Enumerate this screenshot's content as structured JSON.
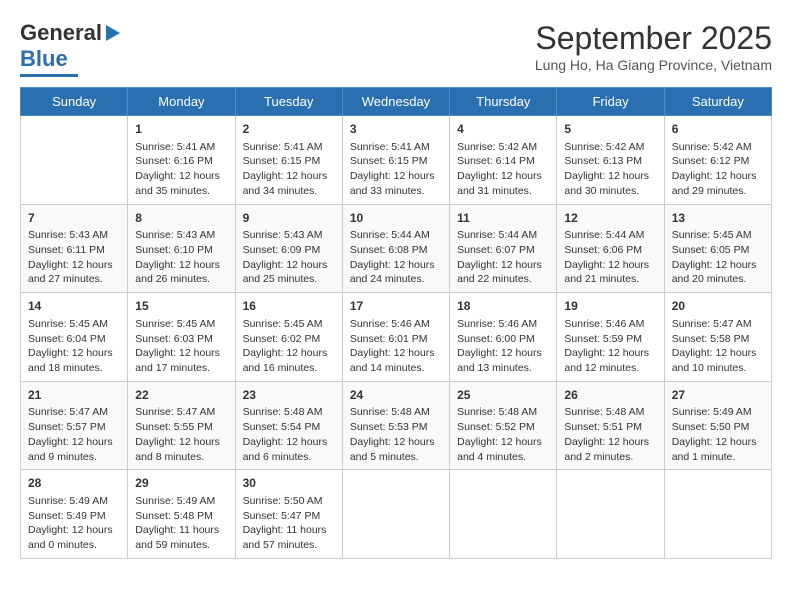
{
  "logo": {
    "line1": "General",
    "line2": "Blue"
  },
  "title": "September 2025",
  "subtitle": "Lung Ho, Ha Giang Province, Vietnam",
  "days_of_week": [
    "Sunday",
    "Monday",
    "Tuesday",
    "Wednesday",
    "Thursday",
    "Friday",
    "Saturday"
  ],
  "weeks": [
    [
      {
        "num": "",
        "info": ""
      },
      {
        "num": "1",
        "info": "Sunrise: 5:41 AM\nSunset: 6:16 PM\nDaylight: 12 hours\nand 35 minutes."
      },
      {
        "num": "2",
        "info": "Sunrise: 5:41 AM\nSunset: 6:15 PM\nDaylight: 12 hours\nand 34 minutes."
      },
      {
        "num": "3",
        "info": "Sunrise: 5:41 AM\nSunset: 6:15 PM\nDaylight: 12 hours\nand 33 minutes."
      },
      {
        "num": "4",
        "info": "Sunrise: 5:42 AM\nSunset: 6:14 PM\nDaylight: 12 hours\nand 31 minutes."
      },
      {
        "num": "5",
        "info": "Sunrise: 5:42 AM\nSunset: 6:13 PM\nDaylight: 12 hours\nand 30 minutes."
      },
      {
        "num": "6",
        "info": "Sunrise: 5:42 AM\nSunset: 6:12 PM\nDaylight: 12 hours\nand 29 minutes."
      }
    ],
    [
      {
        "num": "7",
        "info": "Sunrise: 5:43 AM\nSunset: 6:11 PM\nDaylight: 12 hours\nand 27 minutes."
      },
      {
        "num": "8",
        "info": "Sunrise: 5:43 AM\nSunset: 6:10 PM\nDaylight: 12 hours\nand 26 minutes."
      },
      {
        "num": "9",
        "info": "Sunrise: 5:43 AM\nSunset: 6:09 PM\nDaylight: 12 hours\nand 25 minutes."
      },
      {
        "num": "10",
        "info": "Sunrise: 5:44 AM\nSunset: 6:08 PM\nDaylight: 12 hours\nand 24 minutes."
      },
      {
        "num": "11",
        "info": "Sunrise: 5:44 AM\nSunset: 6:07 PM\nDaylight: 12 hours\nand 22 minutes."
      },
      {
        "num": "12",
        "info": "Sunrise: 5:44 AM\nSunset: 6:06 PM\nDaylight: 12 hours\nand 21 minutes."
      },
      {
        "num": "13",
        "info": "Sunrise: 5:45 AM\nSunset: 6:05 PM\nDaylight: 12 hours\nand 20 minutes."
      }
    ],
    [
      {
        "num": "14",
        "info": "Sunrise: 5:45 AM\nSunset: 6:04 PM\nDaylight: 12 hours\nand 18 minutes."
      },
      {
        "num": "15",
        "info": "Sunrise: 5:45 AM\nSunset: 6:03 PM\nDaylight: 12 hours\nand 17 minutes."
      },
      {
        "num": "16",
        "info": "Sunrise: 5:45 AM\nSunset: 6:02 PM\nDaylight: 12 hours\nand 16 minutes."
      },
      {
        "num": "17",
        "info": "Sunrise: 5:46 AM\nSunset: 6:01 PM\nDaylight: 12 hours\nand 14 minutes."
      },
      {
        "num": "18",
        "info": "Sunrise: 5:46 AM\nSunset: 6:00 PM\nDaylight: 12 hours\nand 13 minutes."
      },
      {
        "num": "19",
        "info": "Sunrise: 5:46 AM\nSunset: 5:59 PM\nDaylight: 12 hours\nand 12 minutes."
      },
      {
        "num": "20",
        "info": "Sunrise: 5:47 AM\nSunset: 5:58 PM\nDaylight: 12 hours\nand 10 minutes."
      }
    ],
    [
      {
        "num": "21",
        "info": "Sunrise: 5:47 AM\nSunset: 5:57 PM\nDaylight: 12 hours\nand 9 minutes."
      },
      {
        "num": "22",
        "info": "Sunrise: 5:47 AM\nSunset: 5:55 PM\nDaylight: 12 hours\nand 8 minutes."
      },
      {
        "num": "23",
        "info": "Sunrise: 5:48 AM\nSunset: 5:54 PM\nDaylight: 12 hours\nand 6 minutes."
      },
      {
        "num": "24",
        "info": "Sunrise: 5:48 AM\nSunset: 5:53 PM\nDaylight: 12 hours\nand 5 minutes."
      },
      {
        "num": "25",
        "info": "Sunrise: 5:48 AM\nSunset: 5:52 PM\nDaylight: 12 hours\nand 4 minutes."
      },
      {
        "num": "26",
        "info": "Sunrise: 5:48 AM\nSunset: 5:51 PM\nDaylight: 12 hours\nand 2 minutes."
      },
      {
        "num": "27",
        "info": "Sunrise: 5:49 AM\nSunset: 5:50 PM\nDaylight: 12 hours\nand 1 minute."
      }
    ],
    [
      {
        "num": "28",
        "info": "Sunrise: 5:49 AM\nSunset: 5:49 PM\nDaylight: 12 hours\nand 0 minutes."
      },
      {
        "num": "29",
        "info": "Sunrise: 5:49 AM\nSunset: 5:48 PM\nDaylight: 11 hours\nand 59 minutes."
      },
      {
        "num": "30",
        "info": "Sunrise: 5:50 AM\nSunset: 5:47 PM\nDaylight: 11 hours\nand 57 minutes."
      },
      {
        "num": "",
        "info": ""
      },
      {
        "num": "",
        "info": ""
      },
      {
        "num": "",
        "info": ""
      },
      {
        "num": "",
        "info": ""
      }
    ]
  ]
}
